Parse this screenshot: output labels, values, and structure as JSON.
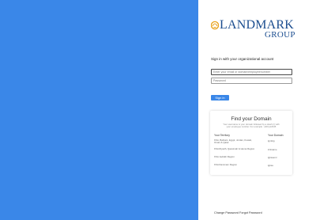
{
  "brand": {
    "name_line1": "LANDMARK",
    "name_line2": "GROUP",
    "accent_color": "#3a87e8",
    "logo_color": "#1b4d8f",
    "icon": "landmark-emblem-icon"
  },
  "signin": {
    "heading": "Sign in with your organizational account",
    "email_placeholder": "Enter your email or domain\\employeenumber",
    "password_placeholder": "Password",
    "button_label": "Sign in"
  },
  "find_domain": {
    "title": "Find your Domain",
    "description": "Your username is your domain followed by a slash (\\) with your employee number. For example : abh\\p12345",
    "headers": {
      "territory": "Your Territory",
      "domain": "Your Domain"
    },
    "rows": [
      {
        "territory": "KSA, Bahrain, Egypt, Jordan, Kuwait, Oman & Qatar",
        "domain": "lgmktg"
      },
      {
        "territory": "KSA Riyadh, Qassimah & Hema Region",
        "domain": "lcrksame"
      },
      {
        "territory": "KSA Jeddah Region",
        "domain": "lgksaemr"
      },
      {
        "territory": "KSA Dammam Region",
        "domain": "lgksa"
      }
    ]
  },
  "footer": {
    "change_password": "Change Password",
    "forgot_password": "Forgot Password"
  }
}
